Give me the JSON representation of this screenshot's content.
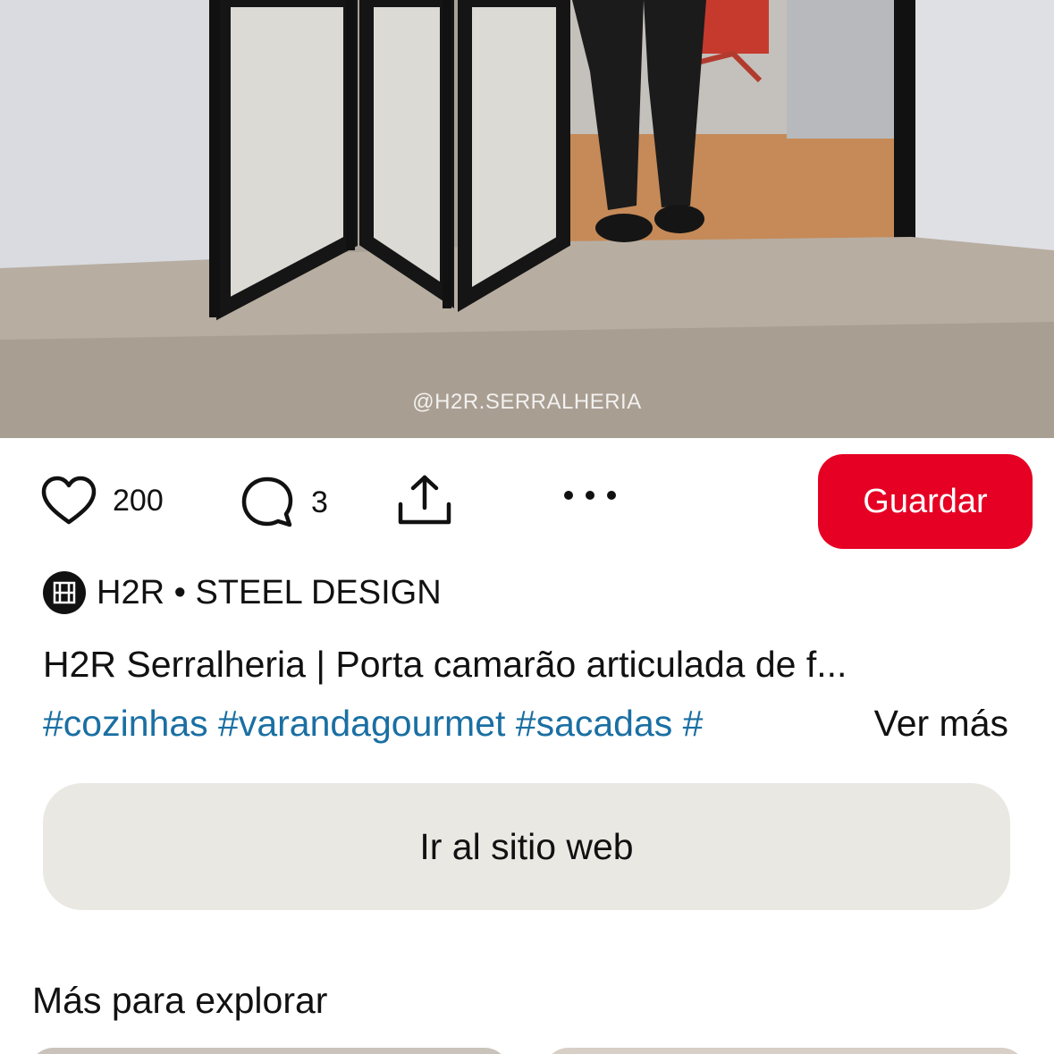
{
  "media": {
    "watermark": "@H2R.SERRALHERIA"
  },
  "actions": {
    "like_count": "200",
    "comment_count": "3",
    "save_label": "Guardar"
  },
  "creator": {
    "name": "H2R • STEEL DESIGN"
  },
  "pin": {
    "title": "H2R Serralheria | Porta camarão articulada de f...",
    "tags": "#cozinhas #varandagourmet #sacadas #",
    "see_more_label": "Ver más"
  },
  "website_button_label": "Ir al sitio web",
  "explore": {
    "title": "Más para explorar"
  },
  "colors": {
    "save_button": "#e60023",
    "hashtag": "#1a6fa3",
    "website_button": "#e9e8e3"
  },
  "icons": [
    "heart-icon",
    "comment-icon",
    "share-icon",
    "more-icon"
  ]
}
